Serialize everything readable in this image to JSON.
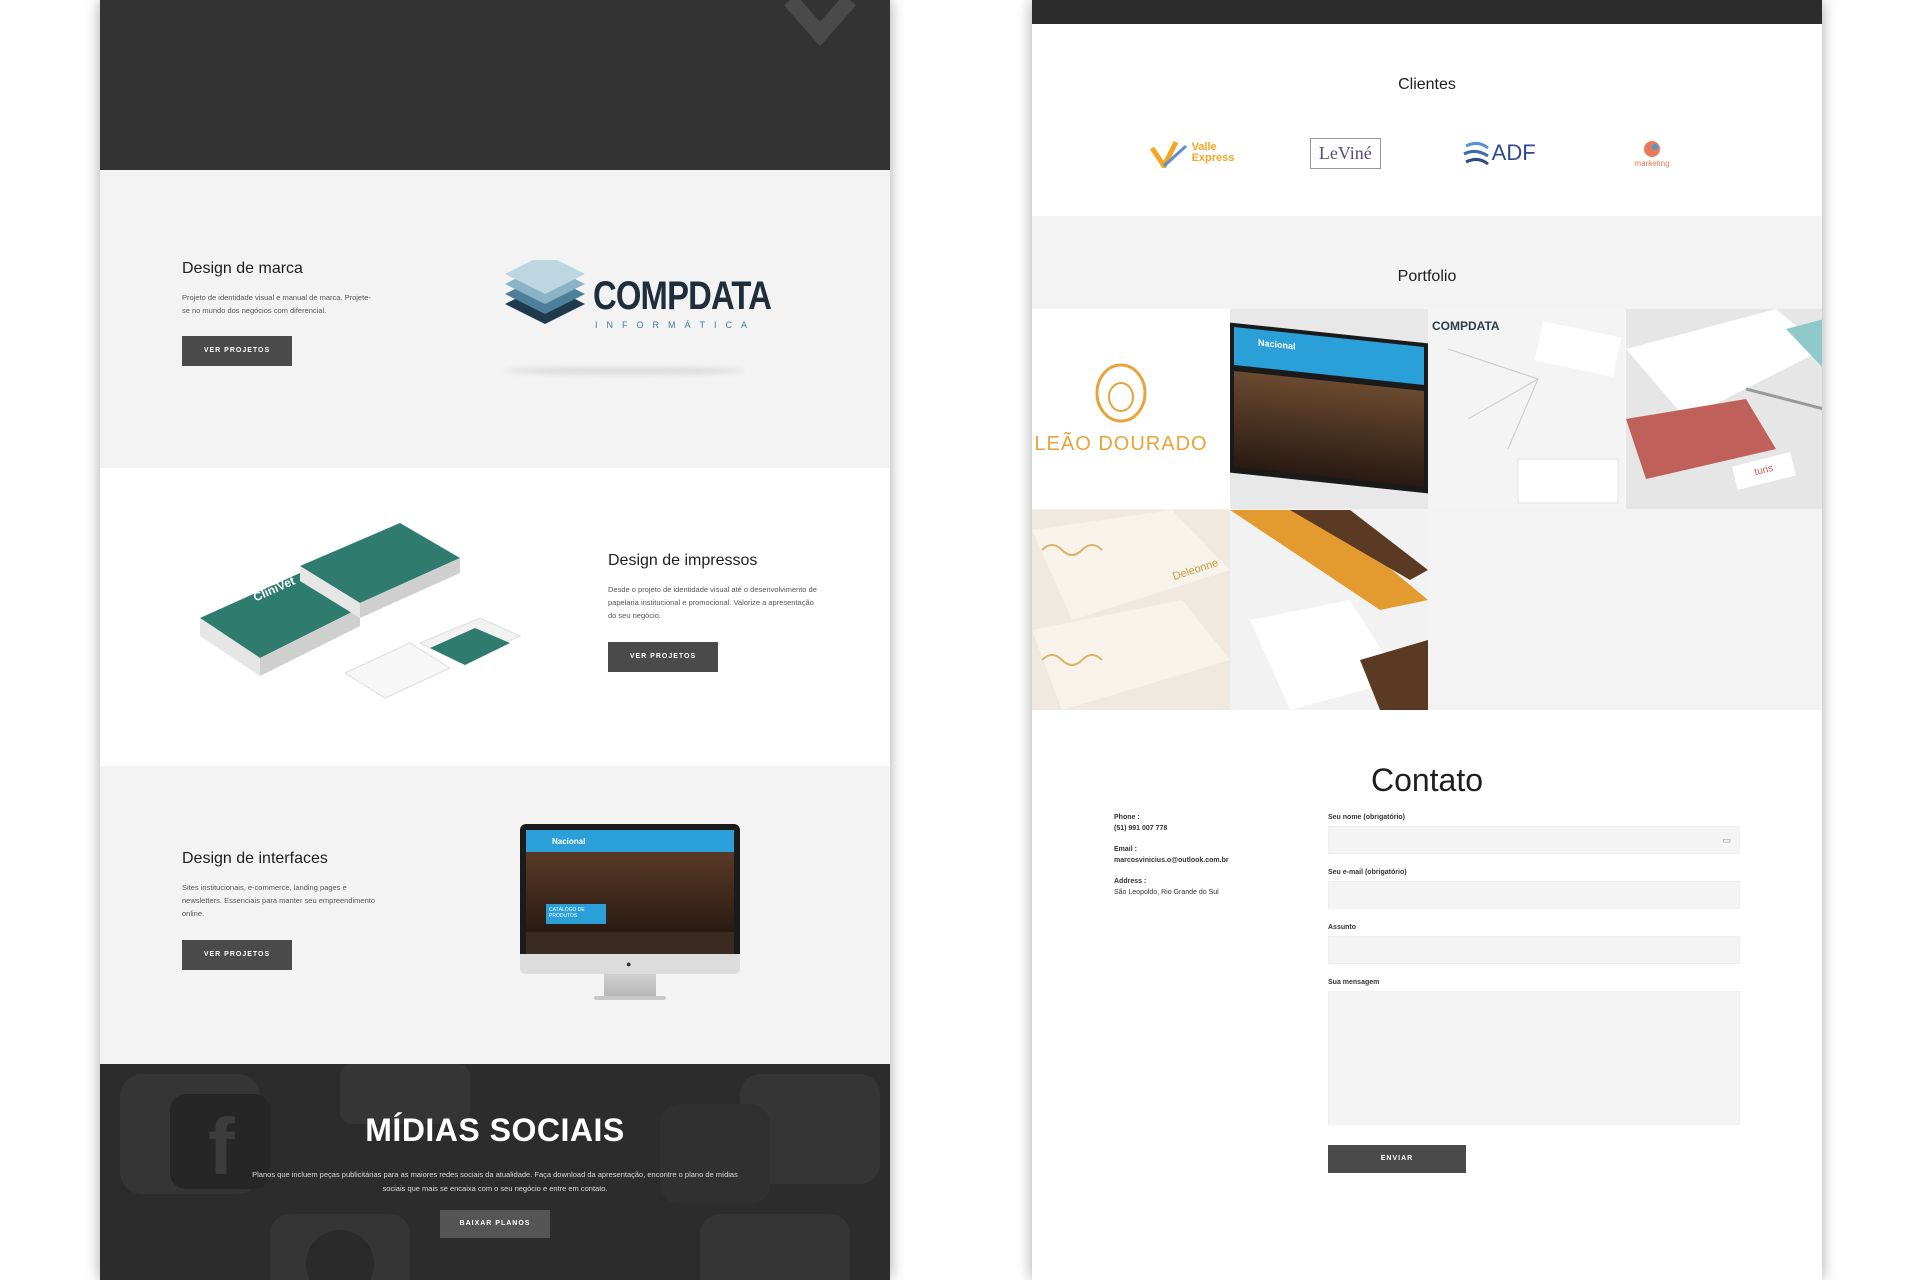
{
  "left_page": {
    "brand_section": {
      "title": "Design de marca",
      "text": "Projeto de identidade visual e manual de marca. Projete-se no mundo dos negócios com diferencial.",
      "button": "VER PROJETOS",
      "logo_main": "COMPDATA",
      "logo_sub": "INFORMÁTICA"
    },
    "print_section": {
      "title": "Design de impressos",
      "text": "Desde o projeto de identidade visual até o desenvolvimento de papelaria institucional e promocional. Valorize a apresentação do seu negócio.",
      "button": "VER PROJETOS",
      "card_brand": "CliniVet"
    },
    "ui_section": {
      "title": "Design de interfaces",
      "text": "Sites institucionais, e-commerce, landing pages e newsletters. Essenciais para manter seu empreendimento online.",
      "button": "VER PROJETOS",
      "screen_brand": "Nacional",
      "screen_banner": "CATÁLOGO DE PRODUTOS"
    },
    "social_section": {
      "title": "MÍDIAS SOCIAIS",
      "text": "Planos que incluem peças publicitárias para as maiores redes sociais da atualidade. Faça download da apresentação, encontre o plano de mídias sociais que mais se encaixa com o seu negócio e entre em contato.",
      "button": "BAIXAR PLANOS"
    }
  },
  "right_page": {
    "clients": {
      "title": "Clientes",
      "logos": [
        {
          "name": "Valle Express",
          "line1": "Valle",
          "line2": "Express",
          "color": "#f5a623"
        },
        {
          "name": "LeViné",
          "text": "LeViné",
          "color": "#5a4a7a"
        },
        {
          "name": "ADF",
          "text": "ADF",
          "color": "#2e4a8a"
        },
        {
          "name": "marketing",
          "text": "marketing",
          "color": "#e87a5a"
        }
      ]
    },
    "portfolio": {
      "title": "Portfolio",
      "tiles": [
        {
          "name": "leao-dourado",
          "text": "LEÃO DOURADO"
        },
        {
          "name": "nacional-tv",
          "text": "Nacional"
        },
        {
          "name": "compdata-stationery",
          "text": "COMPDATA"
        },
        {
          "name": "turis-stationery",
          "text": "turis"
        },
        {
          "name": "deleonne-cards",
          "text": "Deleonne"
        },
        {
          "name": "orange-stationery",
          "text": ""
        }
      ]
    },
    "contact": {
      "title": "Contato",
      "phone_label": "Phone :",
      "phone": "(51) 991 007 778",
      "email_label": "Email :",
      "email": "marcosvinicius.o@outlook.com.br",
      "address_label": "Address :",
      "address": "São Leopoldo, Rio Grande do Sul",
      "fields": [
        {
          "label": "Seu nome (obrigatório)"
        },
        {
          "label": "Seu e-mail (obrigatório)"
        },
        {
          "label": "Assunto"
        },
        {
          "label": "Sua mensagem"
        }
      ],
      "submit": "ENVIAR"
    }
  }
}
